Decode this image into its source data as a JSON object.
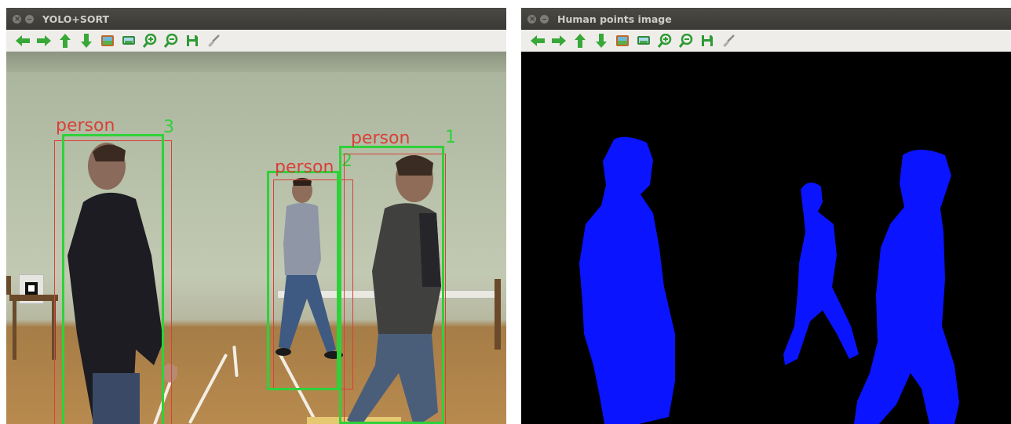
{
  "windows": [
    {
      "title": "YOLO+SORT",
      "detections": [
        {
          "label": "person",
          "id": "3"
        },
        {
          "label": "person",
          "id": "2"
        },
        {
          "label": "person",
          "id": "1"
        }
      ]
    },
    {
      "title": "Human points image"
    }
  ],
  "toolbar": {
    "buttons": [
      {
        "icon": "arrow-left-icon"
      },
      {
        "icon": "arrow-right-icon"
      },
      {
        "icon": "arrow-up-icon"
      },
      {
        "icon": "arrow-down-icon"
      },
      {
        "icon": "image-icon"
      },
      {
        "icon": "image-info-icon"
      },
      {
        "icon": "zoom-in-icon"
      },
      {
        "icon": "zoom-out-icon"
      },
      {
        "icon": "save-icon"
      },
      {
        "icon": "properties-brush-icon"
      }
    ]
  },
  "colors": {
    "box_red": "#d9403a",
    "box_green": "#2fd13a",
    "mask_blue": "#0a14ff",
    "mask_bg": "#000000",
    "toolbar_green": "#3aa63a"
  }
}
